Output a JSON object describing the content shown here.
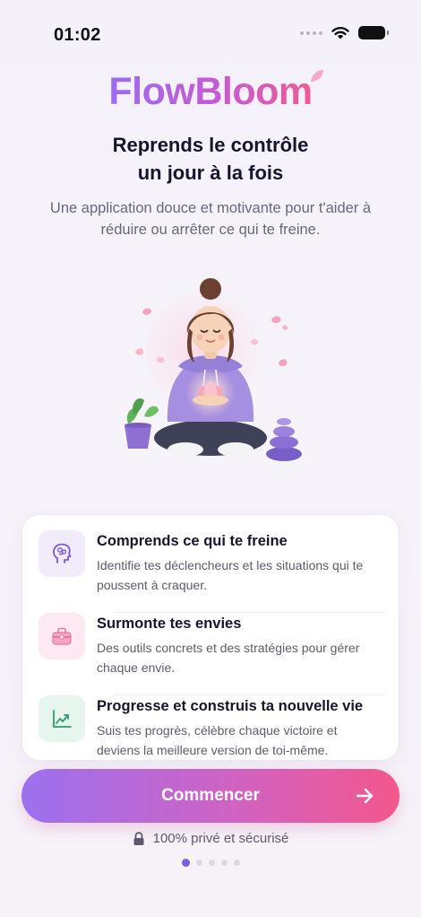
{
  "status_bar": {
    "time": "01:02"
  },
  "brand": {
    "name": "FlowBloom"
  },
  "hero": {
    "headline_line1": "Reprends le contrôle",
    "headline_line2": "un jour à la fois",
    "subtitle": "Une application douce et motivante pour t'aider à réduire ou arrêter ce qui te freine."
  },
  "features": [
    {
      "title": "Comprends ce qui te freine",
      "description": "Identifie tes déclencheurs et les situations qui te poussent à craquer.",
      "icon": "brain-head-icon"
    },
    {
      "title": "Surmonte tes envies",
      "description": "Des outils concrets et des stratégies pour gérer chaque envie.",
      "icon": "toolbox-icon"
    },
    {
      "title": "Progresse et construis ta nouvelle vie",
      "description": "Suis tes progrès, célèbre chaque victoire et deviens la meilleure version de toi-même.",
      "icon": "trend-chart-icon"
    }
  ],
  "cta": {
    "label": "Commencer"
  },
  "privacy": {
    "text": "100% privé et sécurisé"
  },
  "pagination": {
    "total": 5,
    "current": 1
  },
  "colors": {
    "accent_purple": "#9a6ef0",
    "accent_pink": "#f25a93",
    "active_dot": "#7e5ae6",
    "success_green": "#2e9d6b"
  }
}
